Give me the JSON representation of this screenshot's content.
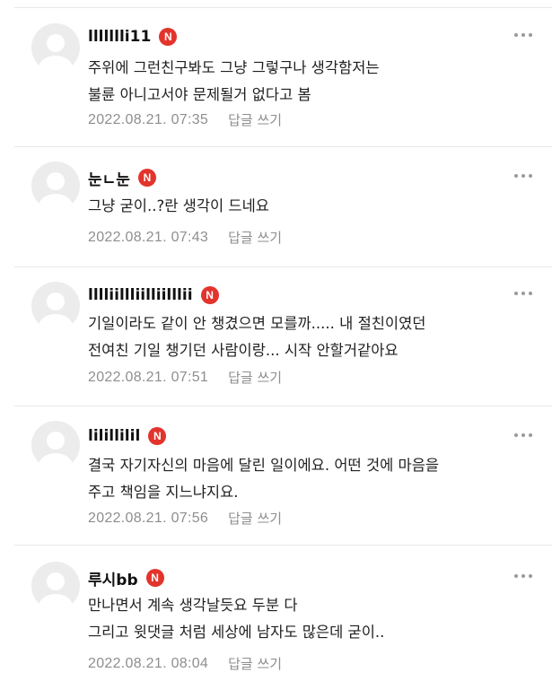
{
  "comments": [
    {
      "nickname": "llllllli11",
      "badge": "N",
      "text": "주위에 그런친구봐도 그냥 그렇구나 생각함저는\n불륜 아니고서야 문제될거 없다고 봄",
      "date": "2022.08.21. 07:35",
      "reply_label": "답글 쓰기"
    },
    {
      "nickname": "눈ㄴ눈",
      "badge": "N",
      "text": "그냥 굳이..?란 생각이 드네요",
      "date": "2022.08.21. 07:43",
      "reply_label": "답글 쓰기"
    },
    {
      "nickname": "lllliillliilliilllii",
      "badge": "N",
      "text": "기일이라도 같이 안 챙겼으면 모를까..... 내 절친이였던\n전여친 기일 챙기던 사람이랑... 시작 안할거같아요",
      "date": "2022.08.21. 07:51",
      "reply_label": "답글 쓰기"
    },
    {
      "nickname": "lilillilil",
      "badge": "N",
      "text": "결국 자기자신의 마음에 달린 일이에요. 어떤 것에 마음을\n주고 책임을 지느냐지요.",
      "date": "2022.08.21. 07:56",
      "reply_label": "답글 쓰기"
    },
    {
      "nickname": "루시bb",
      "badge": "N",
      "text": "만나면서 계속 생각날듯요 두분 다\n그리고 윗댓글 처럼 세상에 남자도 많은데 굳이..",
      "date": "2022.08.21. 08:04",
      "reply_label": "답글 쓰기"
    }
  ],
  "icons": {
    "avatar": "default-profile-icon",
    "more": "more-dots-icon"
  },
  "colors": {
    "badge": "#e2342c",
    "meta": "#8e8e8e",
    "divider": "#e8e8e8"
  }
}
